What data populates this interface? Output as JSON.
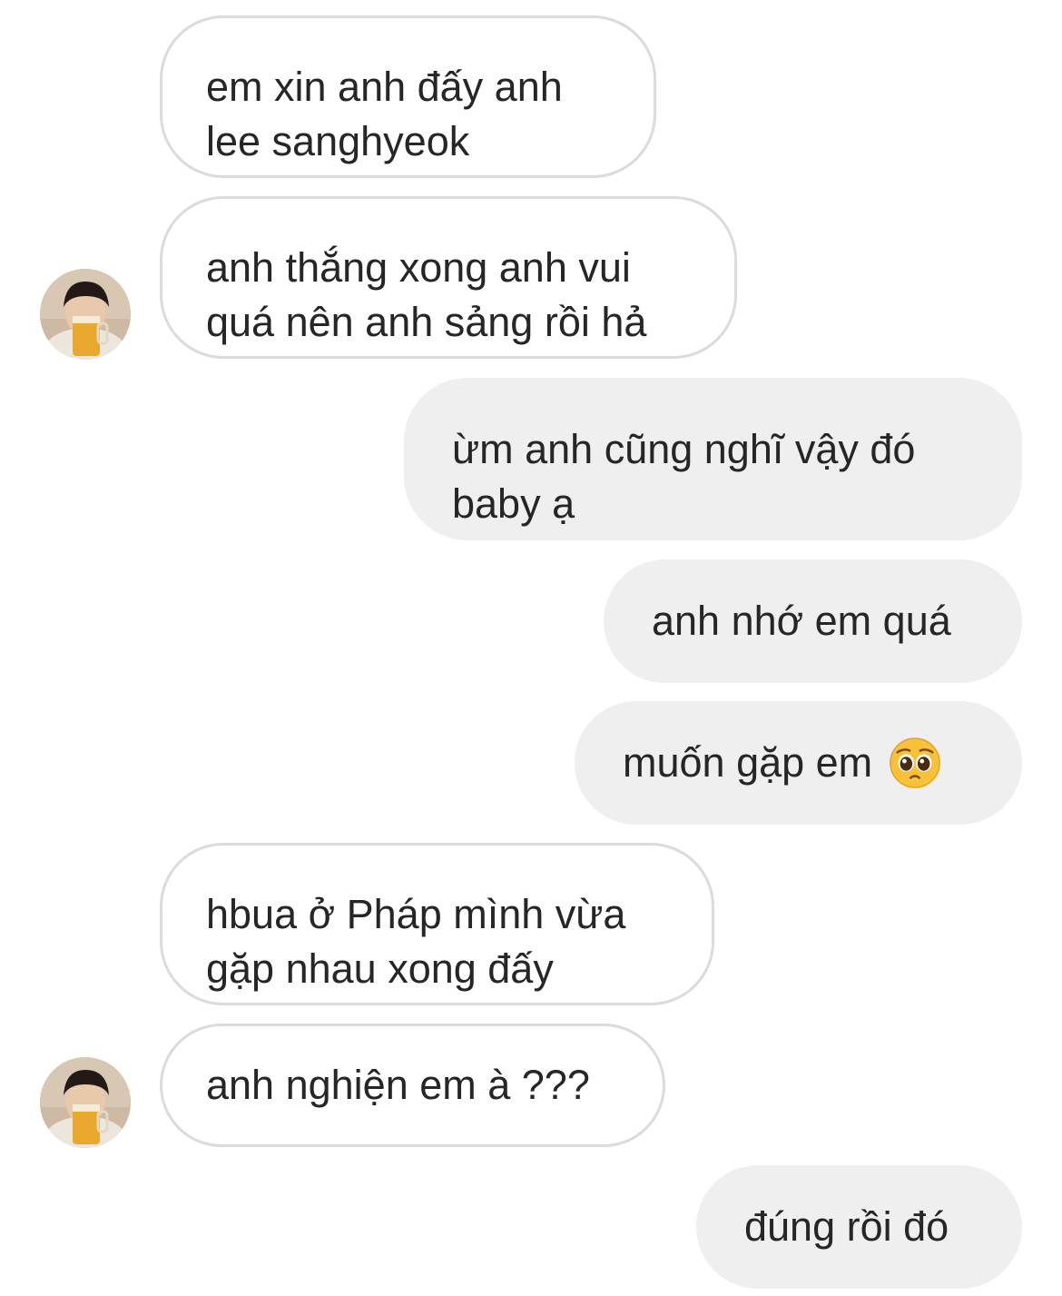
{
  "messages": [
    {
      "direction": "incoming",
      "lines": [
        "em xin anh đấy anh",
        "lee sanghyeok"
      ]
    },
    {
      "direction": "incoming",
      "lines": [
        "anh thắng xong anh vui",
        "quá nên anh sảng rồi hả"
      ],
      "avatar": "profile-photo-holding-beer"
    },
    {
      "direction": "outgoing",
      "lines": [
        "ừm anh cũng nghĩ vậy đó",
        "baby ạ"
      ]
    },
    {
      "direction": "outgoing",
      "lines": [
        "anh nhớ em quá"
      ]
    },
    {
      "direction": "outgoing",
      "lines": [
        "muốn gặp em"
      ],
      "emoji": "pleading-face-emoji"
    },
    {
      "direction": "incoming",
      "lines": [
        "hbua ở Pháp mình vừa",
        "gặp nhau xong đấy"
      ]
    },
    {
      "direction": "incoming",
      "lines": [
        "anh nghiện em à ???"
      ],
      "avatar": "profile-photo-holding-beer"
    },
    {
      "direction": "outgoing",
      "lines": [
        "đúng rồi đó"
      ]
    }
  ],
  "colors": {
    "text": "#262626",
    "incoming_border": "#dbdbdb",
    "outgoing_fill": "#efefef",
    "background": "#ffffff"
  }
}
